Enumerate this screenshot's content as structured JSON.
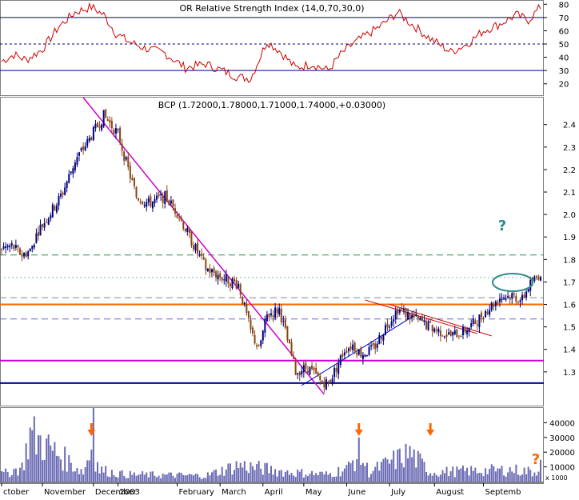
{
  "rsi_panel": {
    "title": "OR Relative Strength Index (14,0,70,30,0)",
    "ticks": [
      "80",
      "70",
      "60",
      "50",
      "40",
      "30",
      "20"
    ],
    "tick_values": [
      80,
      70,
      60,
      50,
      40,
      30,
      20
    ],
    "upper_level": 70,
    "mid_level": 50,
    "lower_level": 30,
    "ylim": [
      12,
      82
    ]
  },
  "price_panel": {
    "title": "BCP (1.72000,1.78000,1.71000,1.74000,+0.03000)",
    "ticks": [
      "2.4",
      "2.3",
      "2.2",
      "2.1",
      "2.0",
      "1.9",
      "1.8",
      "1.7",
      "1.6",
      "1.5",
      "1.4",
      "1.3"
    ],
    "tick_values": [
      2.4,
      2.3,
      2.2,
      2.1,
      2.0,
      1.9,
      1.8,
      1.7,
      1.6,
      1.5,
      1.4,
      1.3
    ],
    "ylim": [
      1.15,
      2.52
    ],
    "annotation_question": "?",
    "horizontal_levels": [
      {
        "value": 1.82,
        "color": "#2e8b57",
        "style": "dashed"
      },
      {
        "value": 1.72,
        "color": "#7fb8b8",
        "style": "dotted"
      },
      {
        "value": 1.63,
        "color": "#888888",
        "style": "dashed"
      },
      {
        "value": 1.6,
        "color": "#ff6600",
        "style": "solid"
      },
      {
        "value": 1.535,
        "color": "#6666cc",
        "style": "dashed"
      },
      {
        "value": 1.35,
        "color": "#cc00cc",
        "style": "solid"
      },
      {
        "value": 1.25,
        "color": "#000099",
        "style": "solid"
      }
    ]
  },
  "volume_panel": {
    "ticks": [
      "40000",
      "30000",
      "20000",
      "10000"
    ],
    "tick_values": [
      40000,
      30000,
      20000,
      10000
    ],
    "unit": "x 1000",
    "ylim": [
      0,
      50000
    ],
    "annotation_question": "?"
  },
  "x_axis": {
    "labels": [
      "ctober",
      "November",
      "December",
      "2003",
      "February",
      "March",
      "April",
      "May",
      "June",
      "July",
      "August",
      "Septemb"
    ]
  },
  "colors": {
    "up_candle": "#000080",
    "down_candle": "#8b4513",
    "rsi_line": "#cc0000",
    "trend_magenta": "#cc00cc",
    "trend_blue": "#0000cc",
    "trend_red": "#cc0000",
    "volume": "#6b6bb5",
    "annotation_arrow": "#ff6600",
    "annotation_teal": "#2e8b8b"
  },
  "chart_data": {
    "type": "candlestick",
    "symbol": "BCP",
    "last_bar": {
      "open": 1.72,
      "high": 1.78,
      "low": 1.71,
      "close": 1.74,
      "change": 0.03
    },
    "price_anchors": {
      "x": [
        0,
        5,
        10,
        14,
        18,
        22,
        27,
        30,
        36,
        42,
        50,
        57,
        62,
        66,
        72,
        80,
        86,
        92,
        100,
        108,
        116,
        122,
        126,
        130,
        136,
        144,
        150,
        156,
        160,
        164,
        168,
        172,
        176,
        182,
        188,
        194,
        200,
        210,
        220,
        226,
        232,
        238,
        244,
        250,
        255,
        258,
        264
      ],
      "y": [
        1.85,
        1.86,
        1.82,
        1.84,
        1.93,
        1.98,
        2.05,
        2.1,
        2.24,
        2.32,
        2.44,
        2.36,
        2.2,
        2.08,
        2.05,
        2.08,
        2.01,
        1.9,
        1.76,
        1.72,
        1.69,
        1.48,
        1.4,
        1.55,
        1.58,
        1.3,
        1.32,
        1.26,
        1.25,
        1.32,
        1.4,
        1.42,
        1.38,
        1.4,
        1.5,
        1.58,
        1.55,
        1.5,
        1.46,
        1.48,
        1.52,
        1.58,
        1.63,
        1.64,
        1.62,
        1.68,
        1.74
      ]
    },
    "rsi_anchors": {
      "x": [
        0,
        6,
        12,
        20,
        28,
        36,
        44,
        50,
        56,
        62,
        70,
        80,
        90,
        100,
        108,
        116,
        122,
        126,
        130,
        136,
        144,
        152,
        160,
        166,
        172,
        178,
        186,
        194,
        200,
        210,
        220,
        228,
        236,
        244,
        252,
        258,
        264
      ],
      "y": [
        37,
        42,
        38,
        46,
        63,
        74,
        78,
        72,
        58,
        52,
        47,
        43,
        32,
        35,
        30,
        25,
        24,
        38,
        52,
        45,
        32,
        35,
        30,
        42,
        50,
        56,
        64,
        74,
        66,
        54,
        44,
        50,
        60,
        65,
        72,
        68,
        78
      ]
    },
    "volume_anchors": {
      "x": [
        0,
        10,
        14,
        40,
        44,
        48,
        60,
        100,
        116,
        140,
        160,
        170,
        175,
        180,
        200,
        210,
        230,
        250,
        262,
        264
      ],
      "y": [
        6000,
        12000,
        40000,
        8000,
        28000,
        10000,
        6000,
        5000,
        14000,
        8000,
        6000,
        12000,
        24000,
        8000,
        24000,
        8000,
        9000,
        10000,
        8000,
        24000
      ]
    }
  }
}
